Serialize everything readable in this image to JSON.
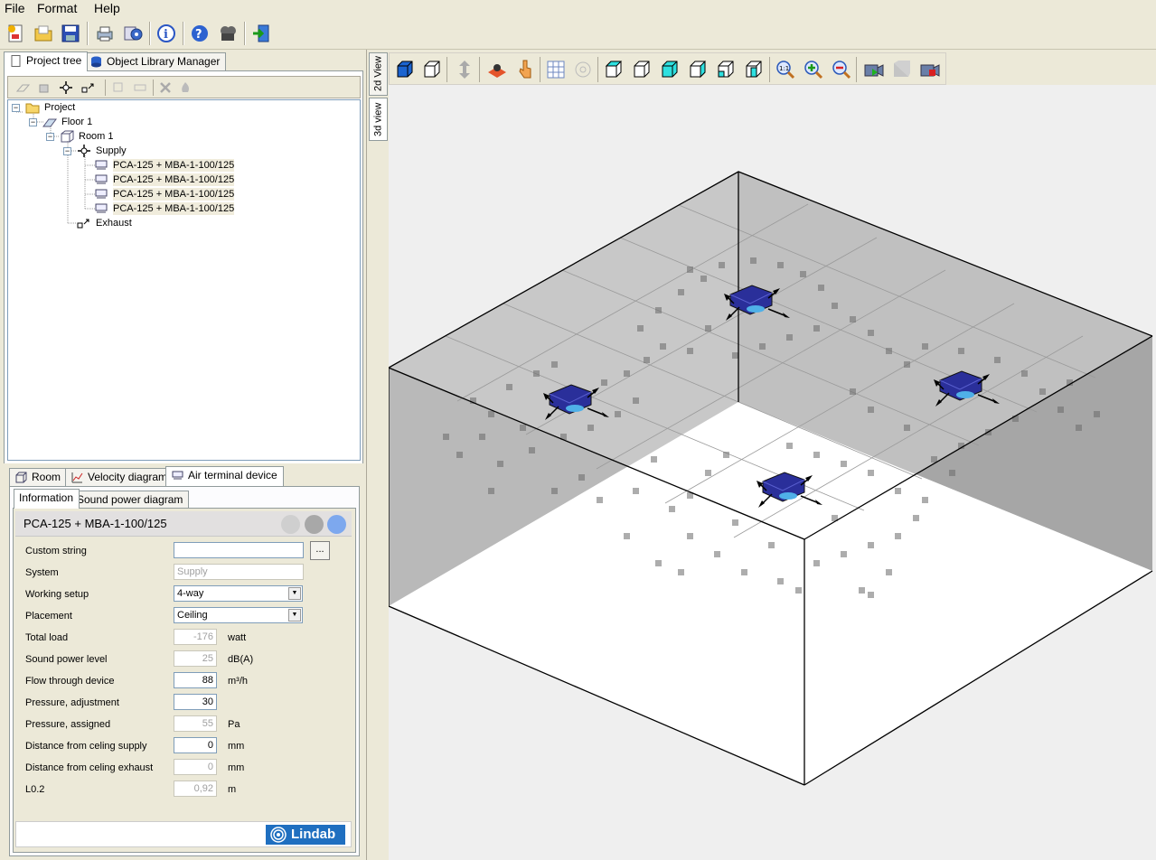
{
  "menu": [
    "File",
    "Format",
    "Help"
  ],
  "tabs_top": {
    "project_tree": "Project tree",
    "object_library": "Object Library Manager"
  },
  "tree": {
    "project": "Project",
    "floor": "Floor 1",
    "room": "Room 1",
    "supply": "Supply",
    "devices": [
      "PCA-125 + MBA-1-100/125",
      "PCA-125 + MBA-1-100/125",
      "PCA-125 + MBA-1-100/125",
      "PCA-125 + MBA-1-100/125"
    ],
    "exhaust": "Exhaust"
  },
  "tabs_bottom": {
    "room": "Room",
    "velocity": "Velocity diagram",
    "air_terminal": "Air terminal device"
  },
  "subtabs": {
    "information": "Information",
    "sound_power": "Sound power diagram"
  },
  "device_title": "PCA-125 + MBA-1-100/125",
  "form": {
    "custom_string": {
      "label": "Custom string",
      "value": "",
      "button": "..."
    },
    "system": {
      "label": "System",
      "value": "Supply"
    },
    "working_setup": {
      "label": "Working setup",
      "value": "4-way"
    },
    "placement": {
      "label": "Placement",
      "value": "Ceiling"
    },
    "total_load": {
      "label": "Total load",
      "value": "-176",
      "unit": "watt"
    },
    "sound_power": {
      "label": "Sound power level",
      "value": "25",
      "unit": "dB(A)"
    },
    "flow": {
      "label": "Flow through device",
      "value": "88",
      "unit": "m³/h"
    },
    "pressure_adj": {
      "label": "Pressure, adjustment",
      "value": "30",
      "unit": ""
    },
    "pressure_assigned": {
      "label": "Pressure, assigned",
      "value": "55",
      "unit": "Pa"
    },
    "dist_supply": {
      "label": "Distance from celing supply",
      "value": "0",
      "unit": "mm"
    },
    "dist_exhaust": {
      "label": "Distance from celing exhaust",
      "value": "0",
      "unit": "mm"
    },
    "l02": {
      "label": "L0.2",
      "value": "0,92",
      "unit": "m"
    }
  },
  "logo": "Lindab",
  "view_tabs": {
    "v2d": "2d View",
    "v3d": "3d view"
  },
  "colors": {
    "window_bg": "#ece9d8",
    "device_blue": "#2a2f9a",
    "field_border": "#7f9db9"
  }
}
